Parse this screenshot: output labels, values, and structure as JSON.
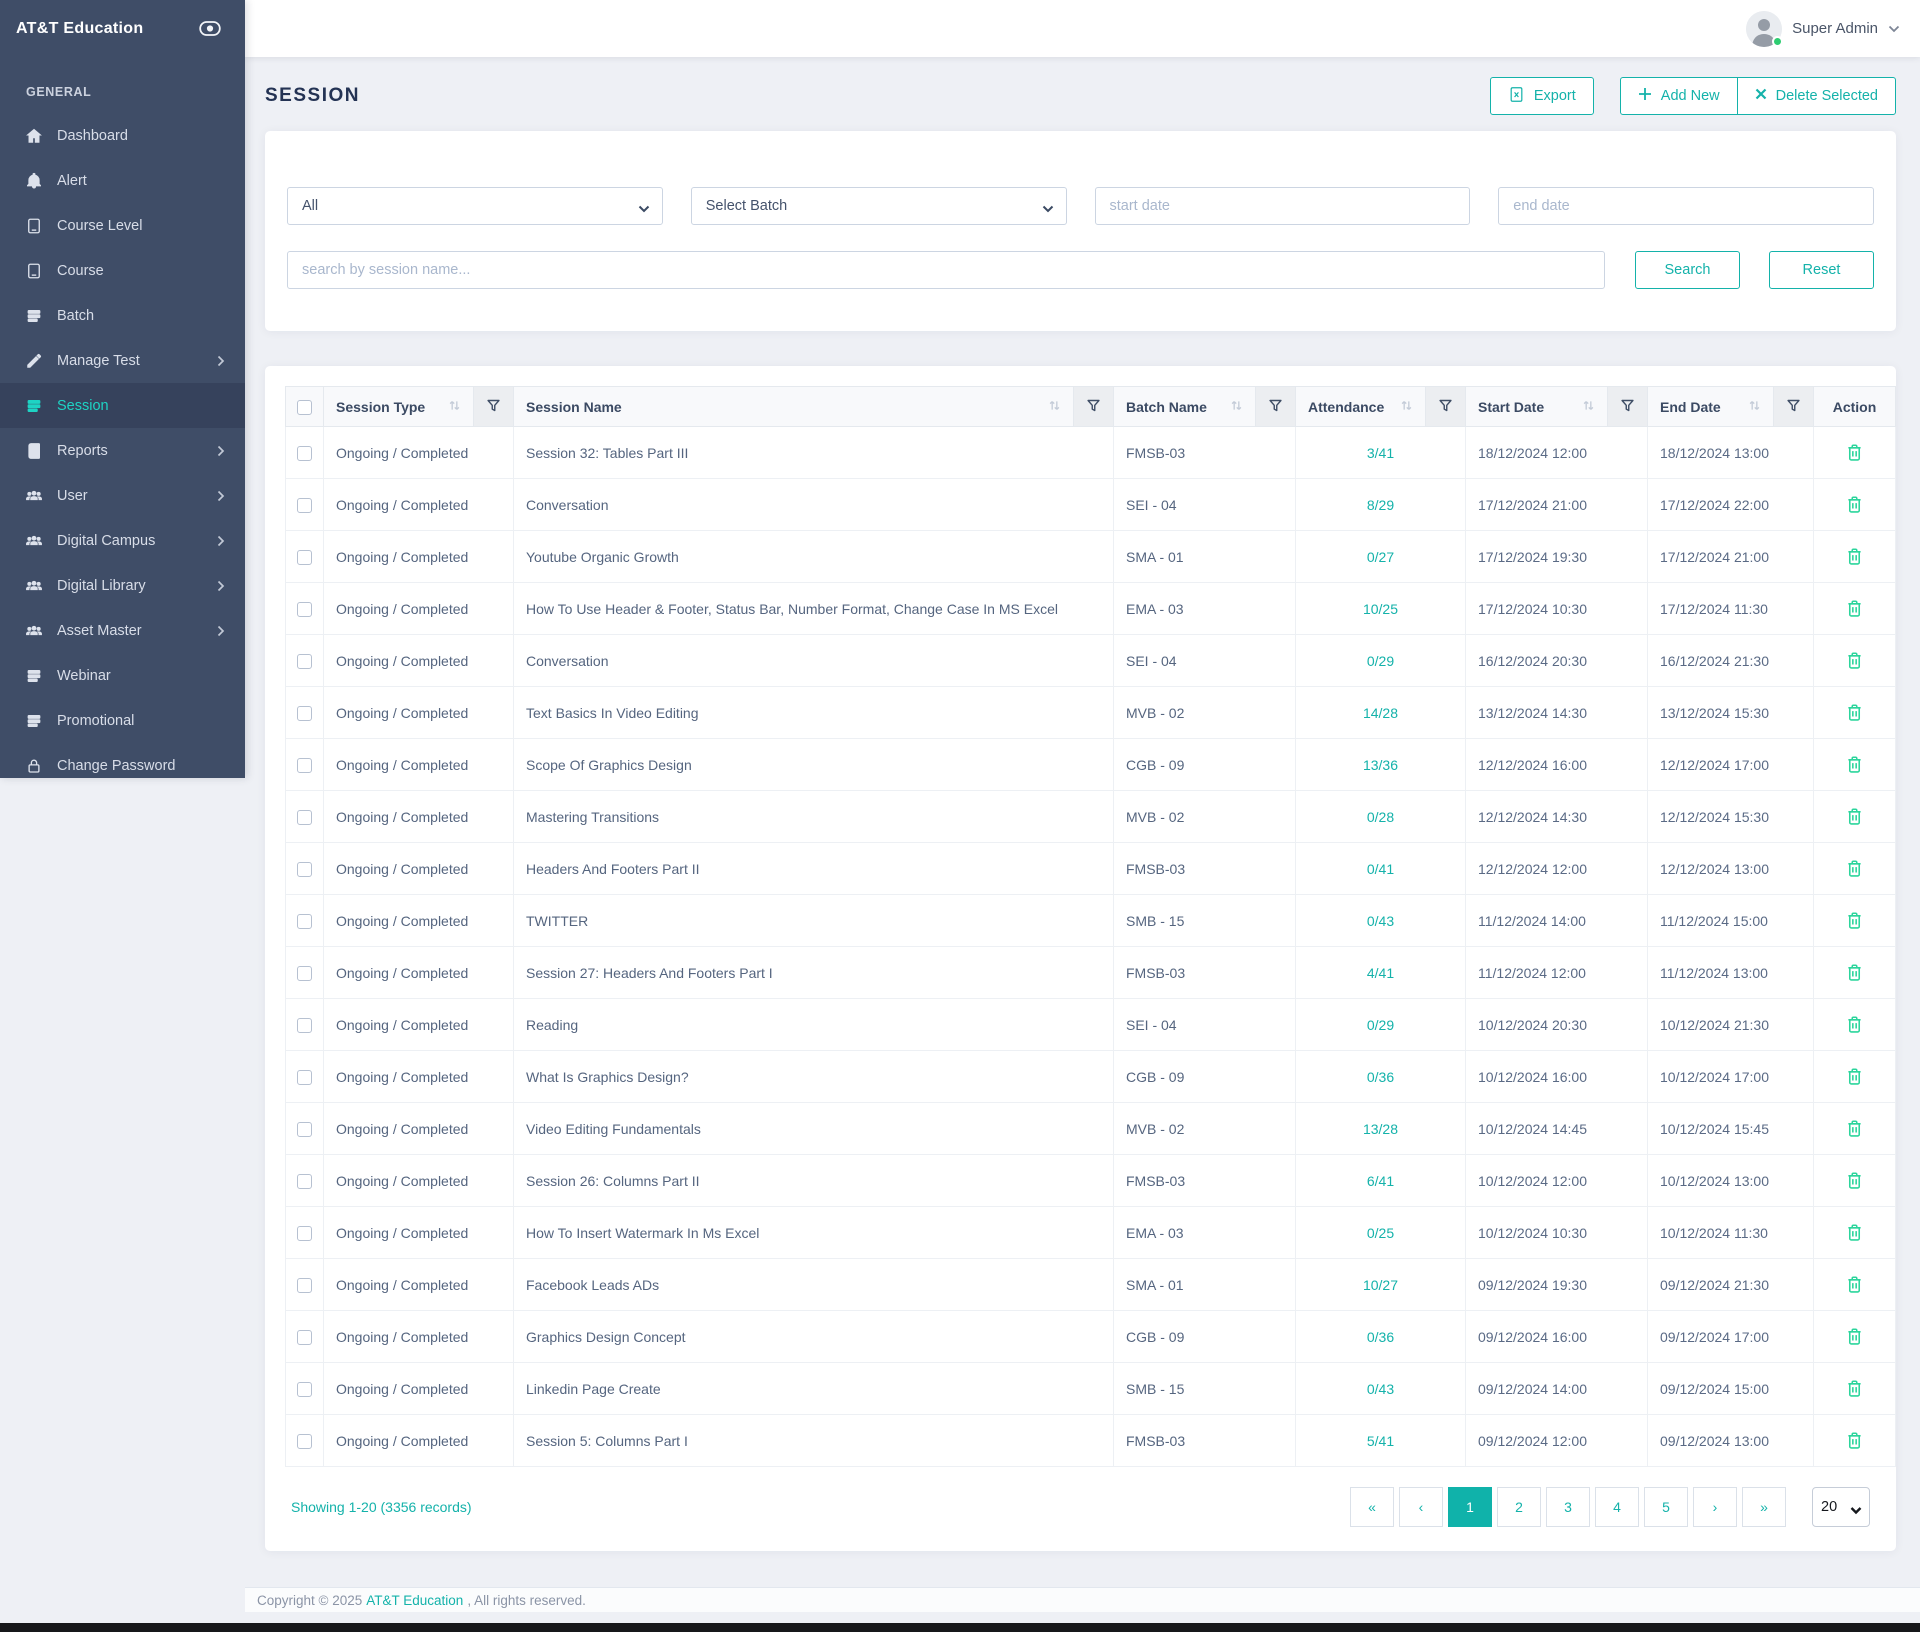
{
  "sidebar": {
    "brand": "AT&T Education",
    "section_label": "GENERAL",
    "items": [
      {
        "id": "dashboard",
        "label": "Dashboard",
        "icon": "home"
      },
      {
        "id": "alert",
        "label": "Alert",
        "icon": "bell"
      },
      {
        "id": "course-level",
        "label": "Course Level",
        "icon": "book"
      },
      {
        "id": "course",
        "label": "Course",
        "icon": "book"
      },
      {
        "id": "batch",
        "label": "Batch",
        "icon": "layers"
      },
      {
        "id": "manage-test",
        "label": "Manage Test",
        "icon": "pencil",
        "submenu": true
      },
      {
        "id": "session",
        "label": "Session",
        "icon": "layers",
        "active": true
      },
      {
        "id": "reports",
        "label": "Reports",
        "icon": "journal",
        "submenu": true
      },
      {
        "id": "user",
        "label": "User",
        "icon": "users",
        "submenu": true
      },
      {
        "id": "digital-campus",
        "label": "Digital Campus",
        "icon": "users",
        "submenu": true
      },
      {
        "id": "digital-library",
        "label": "Digital Library",
        "icon": "users",
        "submenu": true
      },
      {
        "id": "asset-master",
        "label": "Asset Master",
        "icon": "users",
        "submenu": true
      },
      {
        "id": "webinar",
        "label": "Webinar",
        "icon": "layers"
      },
      {
        "id": "promotional",
        "label": "Promotional",
        "icon": "layers"
      },
      {
        "id": "change-password",
        "label": "Change Password",
        "icon": "lock"
      }
    ]
  },
  "header": {
    "user_name": "Super Admin"
  },
  "page": {
    "title": "SESSION",
    "export_label": "Export",
    "add_new_label": "Add New",
    "delete_selected_label": "Delete Selected"
  },
  "filters": {
    "type_selected": "All",
    "batch_selected": "Select Batch",
    "start_date_placeholder": "start date",
    "end_date_placeholder": "end date",
    "search_placeholder": "search by session name...",
    "search_label": "Search",
    "reset_label": "Reset"
  },
  "table": {
    "columns": [
      "Session Type",
      "Session Name",
      "Batch Name",
      "Attendance",
      "Start Date",
      "End Date",
      "Action"
    ],
    "rows": [
      {
        "type": "Ongoing / Completed",
        "name": "Session 32: Tables Part III",
        "batch": "FMSB-03",
        "attendance": "3/41",
        "start": "18/12/2024 12:00",
        "end": "18/12/2024 13:00"
      },
      {
        "type": "Ongoing / Completed",
        "name": "Conversation",
        "batch": "SEI - 04",
        "attendance": "8/29",
        "start": "17/12/2024 21:00",
        "end": "17/12/2024 22:00"
      },
      {
        "type": "Ongoing / Completed",
        "name": "Youtube Organic Growth",
        "batch": "SMA - 01",
        "attendance": "0/27",
        "start": "17/12/2024 19:30",
        "end": "17/12/2024 21:00"
      },
      {
        "type": "Ongoing / Completed",
        "name": "How To Use Header & Footer, Status Bar, Number Format, Change Case In MS Excel",
        "batch": "EMA - 03",
        "attendance": "10/25",
        "start": "17/12/2024 10:30",
        "end": "17/12/2024 11:30"
      },
      {
        "type": "Ongoing / Completed",
        "name": "Conversation",
        "batch": "SEI - 04",
        "attendance": "0/29",
        "start": "16/12/2024 20:30",
        "end": "16/12/2024 21:30"
      },
      {
        "type": "Ongoing / Completed",
        "name": "Text Basics In Video Editing",
        "batch": "MVB - 02",
        "attendance": "14/28",
        "start": "13/12/2024 14:30",
        "end": "13/12/2024 15:30"
      },
      {
        "type": "Ongoing / Completed",
        "name": "Scope Of Graphics Design",
        "batch": "CGB - 09",
        "attendance": "13/36",
        "start": "12/12/2024 16:00",
        "end": "12/12/2024 17:00"
      },
      {
        "type": "Ongoing / Completed",
        "name": "Mastering Transitions",
        "batch": "MVB - 02",
        "attendance": "0/28",
        "start": "12/12/2024 14:30",
        "end": "12/12/2024 15:30"
      },
      {
        "type": "Ongoing / Completed",
        "name": "Headers And Footers Part II",
        "batch": "FMSB-03",
        "attendance": "0/41",
        "start": "12/12/2024 12:00",
        "end": "12/12/2024 13:00"
      },
      {
        "type": "Ongoing / Completed",
        "name": "TWITTER",
        "batch": "SMB - 15",
        "attendance": "0/43",
        "start": "11/12/2024 14:00",
        "end": "11/12/2024 15:00"
      },
      {
        "type": "Ongoing / Completed",
        "name": "Session 27: Headers And Footers Part I",
        "batch": "FMSB-03",
        "attendance": "4/41",
        "start": "11/12/2024 12:00",
        "end": "11/12/2024 13:00"
      },
      {
        "type": "Ongoing / Completed",
        "name": "Reading",
        "batch": "SEI - 04",
        "attendance": "0/29",
        "start": "10/12/2024 20:30",
        "end": "10/12/2024 21:30"
      },
      {
        "type": "Ongoing / Completed",
        "name": "What Is Graphics Design?",
        "batch": "CGB - 09",
        "attendance": "0/36",
        "start": "10/12/2024 16:00",
        "end": "10/12/2024 17:00"
      },
      {
        "type": "Ongoing / Completed",
        "name": "Video Editing Fundamentals",
        "batch": "MVB - 02",
        "attendance": "13/28",
        "start": "10/12/2024 14:45",
        "end": "10/12/2024 15:45"
      },
      {
        "type": "Ongoing / Completed",
        "name": "Session 26: Columns Part II",
        "batch": "FMSB-03",
        "attendance": "6/41",
        "start": "10/12/2024 12:00",
        "end": "10/12/2024 13:00"
      },
      {
        "type": "Ongoing / Completed",
        "name": "How To Insert Watermark In Ms Excel",
        "batch": "EMA - 03",
        "attendance": "0/25",
        "start": "10/12/2024 10:30",
        "end": "10/12/2024 11:30"
      },
      {
        "type": "Ongoing / Completed",
        "name": "Facebook Leads ADs",
        "batch": "SMA - 01",
        "attendance": "10/27",
        "start": "09/12/2024 19:30",
        "end": "09/12/2024 21:30"
      },
      {
        "type": "Ongoing / Completed",
        "name": "Graphics Design Concept",
        "batch": "CGB - 09",
        "attendance": "0/36",
        "start": "09/12/2024 16:00",
        "end": "09/12/2024 17:00"
      },
      {
        "type": "Ongoing / Completed",
        "name": "Linkedin Page Create",
        "batch": "SMB - 15",
        "attendance": "0/43",
        "start": "09/12/2024 14:00",
        "end": "09/12/2024 15:00"
      },
      {
        "type": "Ongoing / Completed",
        "name": "Session 5: Columns Part I",
        "batch": "FMSB-03",
        "attendance": "5/41",
        "start": "09/12/2024 12:00",
        "end": "09/12/2024 13:00"
      }
    ]
  },
  "pagination": {
    "showing": "Showing 1-20 (3356 records)",
    "pages": [
      {
        "label": "«",
        "name": "first-page-button"
      },
      {
        "label": "‹",
        "name": "prev-page-button"
      },
      {
        "label": "1",
        "name": "page-button-1",
        "active": true
      },
      {
        "label": "2",
        "name": "page-button-2"
      },
      {
        "label": "3",
        "name": "page-button-3"
      },
      {
        "label": "4",
        "name": "page-button-4"
      },
      {
        "label": "5",
        "name": "page-button-5"
      },
      {
        "label": "›",
        "name": "next-page-button"
      },
      {
        "label": "»",
        "name": "last-page-button"
      }
    ],
    "per_page": "20"
  },
  "footer": {
    "copyright_prefix": "Copyright © 2025",
    "brand_link": "AT&T Education",
    "copyright_suffix": ", All rights reserved."
  },
  "colors": {
    "accent": "#14b2aa",
    "sidebar_bg": "#3f4d67",
    "sidebar_active": "#1ed3c4",
    "trash_green": "#2cd59c"
  }
}
